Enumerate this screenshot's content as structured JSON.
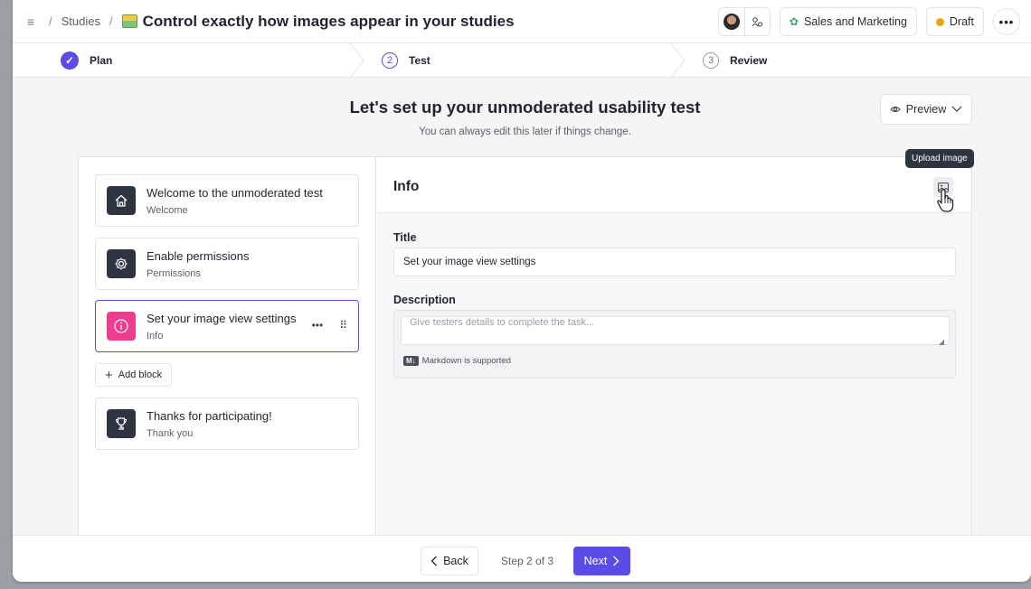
{
  "header": {
    "breadcrumb_root": "Studies",
    "title": "Control exactly how images appear in your studies",
    "workspace_label": "Sales and Marketing",
    "status_label": "Draft"
  },
  "stepper": {
    "steps": [
      {
        "label": "Plan",
        "state": "complete"
      },
      {
        "number": "2",
        "label": "Test",
        "state": "current"
      },
      {
        "number": "3",
        "label": "Review",
        "state": "upcoming"
      }
    ]
  },
  "intro": {
    "title": "Let's set up your unmoderated usability test",
    "subtitle": "You can always edit this later if things change.",
    "preview_label": "Preview"
  },
  "blocks": [
    {
      "title": "Welcome to the unmoderated test",
      "type": "Welcome",
      "icon": "home-icon"
    },
    {
      "title": "Enable permissions",
      "type": "Permissions",
      "icon": "gear-icon"
    },
    {
      "title": "Set your image view settings",
      "type": "Info",
      "icon": "info-icon"
    },
    {
      "title": "Thanks for participating!",
      "type": "Thank you",
      "icon": "trophy-icon"
    }
  ],
  "add_block_label": "Add block",
  "editor": {
    "section_title": "Info",
    "tooltip": "Upload image",
    "title_label": "Title",
    "title_value": "Set your image view settings",
    "description_label": "Description",
    "description_placeholder": "Give testers details to complete the task...",
    "markdown_badge": "M↓",
    "markdown_note": "Markdown is supported"
  },
  "footer": {
    "back_label": "Back",
    "step_text": "Step 2 of 3",
    "next_label": "Next"
  },
  "colors": {
    "accent": "#5b4ce6",
    "draft": "#e8a317",
    "info_icon_bg": "#ee3d8f"
  }
}
